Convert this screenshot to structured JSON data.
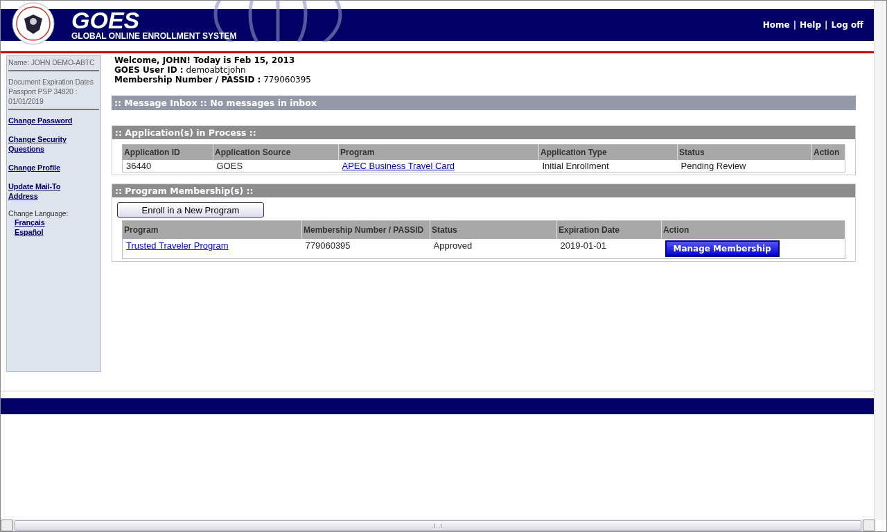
{
  "header": {
    "logo_title": "GOES",
    "logo_subtitle": "GLOBAL ONLINE ENROLLMENT SYSTEM",
    "nav": [
      {
        "label": "Home"
      },
      {
        "label": "Help"
      },
      {
        "label": "Log off"
      }
    ],
    "separators": [
      "|",
      "|"
    ]
  },
  "sidebar": {
    "name": "Name: JOHN DEMO-ABTC",
    "document_lines": [
      "Document Expiration Dates",
      "Passport PSP 34820 :",
      "01/01/2019"
    ],
    "links": [
      {
        "label": "Change Password"
      },
      {
        "label": "Change Security Questions"
      },
      {
        "label": "Change Profile"
      },
      {
        "label": "Update Mail-To Address"
      }
    ],
    "language_label": "Change Language:",
    "languages": [
      {
        "label": "Français"
      },
      {
        "label": "Español"
      }
    ]
  },
  "welcome": [
    "Welcome, JOHN! Today is Feb 15, 2013",
    "**GOES User ID :** demoabtcjohn",
    "**Membership Number / PASSID :** 779060395"
  ],
  "inbox": {
    "title": ":: Message Inbox :: No messages in inbox"
  },
  "applications": {
    "title": ":: Application(s) in Process ::",
    "columns": [
      "Application ID",
      "Application Source",
      "Program",
      "Application Type",
      "Status",
      "Action"
    ],
    "rows": [
      {
        "cells": [
          {
            "kind": "text",
            "text": "36440"
          },
          {
            "kind": "text",
            "text": "GOES"
          },
          {
            "kind": "link",
            "text": "APEC Business Travel Card"
          },
          {
            "kind": "text",
            "text": "Initial Enrollment"
          },
          {
            "kind": "text",
            "text": "Pending Review"
          }
        ]
      }
    ]
  },
  "memberships": {
    "title": ":: Program Membership(s) ::",
    "enroll_button": "Enroll in a New Program",
    "columns": [
      "Program",
      "Membership Number / PASSID",
      "Status",
      "Expiration Date",
      "Action"
    ],
    "rows": [
      {
        "cells": [
          {
            "kind": "link",
            "text": "Trusted Traveler Program"
          },
          {
            "kind": "text",
            "text": "779060395"
          },
          {
            "kind": "text",
            "text": "Approved"
          },
          {
            "kind": "text",
            "text": "2019-01-01"
          },
          {
            "kind": "button",
            "text": "Manage Membership"
          }
        ]
      }
    ]
  }
}
